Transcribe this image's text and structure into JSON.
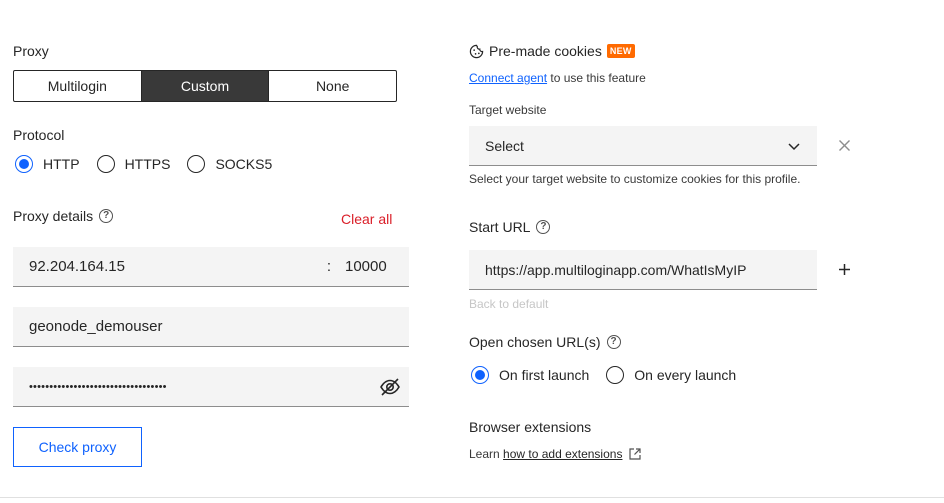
{
  "proxy": {
    "label": "Proxy",
    "options": [
      "Multilogin",
      "Custom",
      "None"
    ],
    "selected": "Custom"
  },
  "protocol": {
    "label": "Protocol",
    "options": [
      "HTTP",
      "HTTPS",
      "SOCKS5"
    ],
    "selected": "HTTP"
  },
  "proxy_details": {
    "label": "Proxy details",
    "clear_label": "Clear all",
    "host": "92.204.164.15",
    "separator": ":",
    "port": "10000",
    "username": "geonode_demouser",
    "password_mask": "••••••••••••••••••••••••••••••••••",
    "check_label": "Check proxy"
  },
  "cookies": {
    "title": "Pre-made cookies",
    "badge": "NEW",
    "connect_link": "Connect agent",
    "connect_suffix": " to use this feature",
    "target_label": "Target website",
    "target_value": "Select",
    "target_help": "Select your target website to customize cookies for this profile."
  },
  "start_url": {
    "label": "Start URL",
    "value": "https://app.multiloginapp.com/WhatIsMyIP",
    "back_default": "Back to default"
  },
  "open_urls": {
    "label": "Open chosen URL(s)",
    "options": [
      "On first launch",
      "On every launch"
    ],
    "selected": "On first launch"
  },
  "extensions": {
    "title": "Browser extensions",
    "prefix": "Learn ",
    "link": "how to add extensions"
  },
  "colors": {
    "accent": "#0f62fe",
    "danger": "#da1e28",
    "badge": "#ff6a00",
    "segment_active": "#393939"
  }
}
